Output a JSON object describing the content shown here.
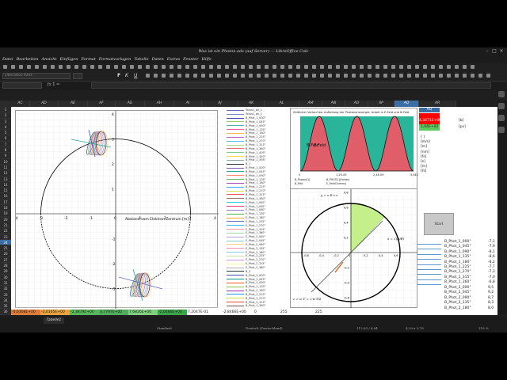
{
  "window": {
    "title": "Was ist ein Photon.ods (auf Server) — LibreOffice Calc"
  },
  "menu": [
    "Datei",
    "Bearbeiten",
    "Ansicht",
    "Einfügen",
    "Format",
    "Formatvorlagen",
    "Tabelle",
    "Daten",
    "Extras",
    "Fenster",
    "Hilfe"
  ],
  "toolbar": {
    "font_name": "Liberation Sans",
    "formula_value": ""
  },
  "columns": [
    "AC",
    "AD",
    "AE",
    "AF",
    "AG",
    "AH",
    "AI",
    "AJ",
    "AK",
    "AL",
    "AM",
    "AN",
    "AO",
    "AP",
    "AQ",
    "AR"
  ],
  "selected_column": "AQ",
  "rows": [
    "1",
    "2",
    "3",
    "4",
    "5",
    "6",
    "7",
    "8",
    "9",
    "10",
    "11",
    "12",
    "13",
    "14",
    "15",
    "16",
    "17",
    "18",
    "19",
    "20",
    "21",
    "22",
    "23",
    "24",
    "25",
    "26",
    "27",
    "28",
    "29",
    "30",
    "31",
    "32",
    "33",
    "34",
    "35",
    "36"
  ],
  "selected_row": "24",
  "chart1": {
    "xlabel": "Abstand vom Elektron Zentrum [m]",
    "x_ticks": [
      "-4",
      "-3",
      "-2",
      "-1",
      "0",
      "1",
      "2",
      "3",
      "4"
    ],
    "y_ticks": [
      "4",
      "3",
      "2",
      "1",
      "0",
      "-1",
      "-2",
      "-3",
      "-4"
    ]
  },
  "chart2": {
    "title": "Zeitlicher Verlauf der Aufteilung der Photonenenergie: Arbeit in E-Feld und B-Feld",
    "labels": [
      "E-Feld",
      "B-Feld"
    ],
    "x_ticks": [
      "0",
      "1,2E-09",
      "2,4E-09",
      "3,6E-09"
    ],
    "legend": [
      "B_Photon[1]",
      "B_PHOT[1](Felder)",
      "B_Feld",
      "E_Feld(Dummy)"
    ]
  },
  "chart3": {
    "formula_top": "y = ε·E·c·ε",
    "formula_right": "x = √(B/B̄)",
    "formula_bottom": "z = ω·T = 2·π·T/λ",
    "ticks": [
      "-0,6",
      "-0,4",
      "-0,2",
      "0",
      "0,2",
      "0,4",
      "0,6"
    ],
    "y_ticks": [
      "0,8",
      "0,6",
      "0,4",
      "0,2",
      "0",
      "-0,2",
      "-0,4",
      "-0,6",
      "-0,8"
    ],
    "mid_label": "Bedienen: z = ω·T = 2·π·T/λ"
  },
  "legend_items": [
    {
      "label": "Torus1_ph_1",
      "color": "#5c6bc0"
    },
    {
      "label": "Torus1_ph_1",
      "color": "#7986cb"
    },
    {
      "label": "B_Phot_1_000°",
      "color": "#3949ab"
    },
    {
      "label": "B_Phot_1_045°",
      "color": "#9ccc65"
    },
    {
      "label": "B_Phot_1_090°",
      "color": "#4db6ac"
    },
    {
      "label": "B_Phot_1_135°",
      "color": "#f06292"
    },
    {
      "label": "B_Phot_1_180°",
      "color": "#ffb74d"
    },
    {
      "label": "B_Phot_1_225°",
      "color": "#ba68c8"
    },
    {
      "label": "B_Phot_1_270°",
      "color": "#4fc3f7"
    },
    {
      "label": "B_Phot_1_315°",
      "color": "#aed581"
    },
    {
      "label": "B_Phot_1_360°",
      "color": "#e57373"
    },
    {
      "label": "B_Phot_1_405°",
      "color": "#81c784"
    },
    {
      "label": "B_Phot_1_450°",
      "color": "#ffd54f"
    },
    {
      "label": "B_Phot_1_495°",
      "color": "#90a4ae"
    },
    {
      "label": "B_1",
      "color": "#263238"
    },
    {
      "label": "B_Phot_1_000°",
      "color": "#7e57c2"
    },
    {
      "label": "B_Phot_1_045°",
      "color": "#26a69a"
    },
    {
      "label": "B_Phot_1_090°",
      "color": "#ff8a65"
    },
    {
      "label": "B_Phot_1_135°",
      "color": "#66bb6a"
    },
    {
      "label": "B_Phot_1_180°",
      "color": "#ab47bc"
    },
    {
      "label": "B_Phot_1_225°",
      "color": "#42a5f5"
    },
    {
      "label": "B_Phot_1_270°",
      "color": "#d4e157"
    },
    {
      "label": "B_Phot_1_315°",
      "color": "#ef5350"
    },
    {
      "label": "B_Phot_1_360°",
      "color": "#8d6e63"
    },
    {
      "label": "E_Phot_1_000°",
      "color": "#26c6da"
    },
    {
      "label": "E_Phot_1_045°",
      "color": "#ec407a"
    },
    {
      "label": "E_Phot_1_090°",
      "color": "#9575cd"
    },
    {
      "label": "E_Phot_1_135°",
      "color": "#4caf50"
    },
    {
      "label": "E_Phot_1_180°",
      "color": "#ffa726"
    },
    {
      "label": "E_Phot_1_225°",
      "color": "#5c6bc0"
    },
    {
      "label": "E_Phot_1_270°",
      "color": "#29b6f6"
    },
    {
      "label": "E_Phot_1_315°",
      "color": "#ef9a9a"
    },
    {
      "label": "E_Phot_1_360°",
      "color": "#a5d6a7"
    },
    {
      "label": "E_Phot_2_000°",
      "color": "#b39ddb"
    },
    {
      "label": "E_Phot_2_045°",
      "color": "#80cbc4"
    },
    {
      "label": "E_Phot_2_090°",
      "color": "#ffcc80"
    },
    {
      "label": "E_Phot_2_135°",
      "color": "#f48fb1"
    },
    {
      "label": "E_Phot_2_180°",
      "color": "#90caf9"
    },
    {
      "label": "E_Phot_2_225°",
      "color": "#c5e1a5"
    },
    {
      "label": "E_Phot_2_270°",
      "color": "#ce93d8"
    },
    {
      "label": "E_Phot_2_315°",
      "color": "#fff59d"
    },
    {
      "label": "E_Phot_2_360°",
      "color": "#bcaaa4"
    },
    {
      "label": "B_2",
      "color": "#263238"
    },
    {
      "label": "B_Phot_2_000°",
      "color": "#3f51b5"
    },
    {
      "label": "B_Phot_2_045°",
      "color": "#009688"
    },
    {
      "label": "B_Phot_2_090°",
      "color": "#ff5722"
    },
    {
      "label": "B_Phot_2_135°",
      "color": "#8bc34a"
    },
    {
      "label": "B_Phot_2_180°",
      "color": "#9c27b0"
    },
    {
      "label": "B_Phot_2_225°",
      "color": "#2196f3"
    },
    {
      "label": "B_Phot_2_270°",
      "color": "#cddc39"
    },
    {
      "label": "B_Phot_2_315°",
      "color": "#f44336"
    },
    {
      "label": "B_Phot_2_360°",
      "color": "#795548"
    },
    {
      "label": "Torus2_ph_2",
      "color": "#000000"
    },
    {
      "label": "Torus2_ph_2",
      "color": "#555555"
    }
  ],
  "right_cells": {
    "r1": "AQ",
    "red_value": "4,3471E+00",
    "red_unit": "[b]",
    "green_value": "1,04E+02",
    "green_unit": "[ps]",
    "units": [
      "[ ]",
      "[m/s]",
      "[m]",
      "[nm]",
      "[fs]",
      "[s]",
      "[m]",
      "[fs]"
    ],
    "start_button": "Start",
    "list_a": [
      "B_Phot_1_000°",
      "B_Phot_1_045°",
      "B_Phot_1_090°",
      "B_Phot_1_135°",
      "B_Phot_1_180°",
      "B_Phot_1_225°",
      "B_Phot_1_270°",
      "B_Phot_1_315°",
      "B_Phot_1_360°"
    ],
    "list_a_vals": [
      "-7,1",
      "-7,9",
      "-8,1",
      "-8,6",
      "-8,2",
      "-7,7",
      "-7,3",
      "-7,0",
      "-6,8"
    ],
    "list_b": [
      "B_Phot_2_000°",
      "B_Phot_2_045°",
      "B_Phot_2_090°",
      "B_Phot_2_135°",
      "B_Phot_2_180°",
      "B_Phot_2_225°"
    ],
    "list_b_vals": [
      "9,5",
      "9,2",
      "8,7",
      "8,3",
      "8,0",
      "7,8"
    ]
  },
  "bottom_row": [
    "-4,6308E+00",
    "-3,0105E+00",
    "-2,3879E+00",
    "3,7797E+00",
    "7,6826E+00",
    "-2,0466E+00",
    "7,2047E-01",
    "-2,8466E+00",
    "0",
    "255",
    "225"
  ],
  "bottom_colors": [
    "#e07b39",
    "#e8a33d",
    "#57b85a",
    "#4fae5e",
    "#7ed07f",
    "#3aa64a",
    "#ffffff",
    "#ffffff",
    "#ffffff",
    "#ffffff",
    "#ffffff"
  ],
  "tabs": [
    "Tabelle1"
  ],
  "status": {
    "left": "Standard",
    "lang": "Deutsch (Deutschland)",
    "info": "112,63 / 8,84",
    "coords": "4,29 x 3,76",
    "zoom": "118 %"
  }
}
